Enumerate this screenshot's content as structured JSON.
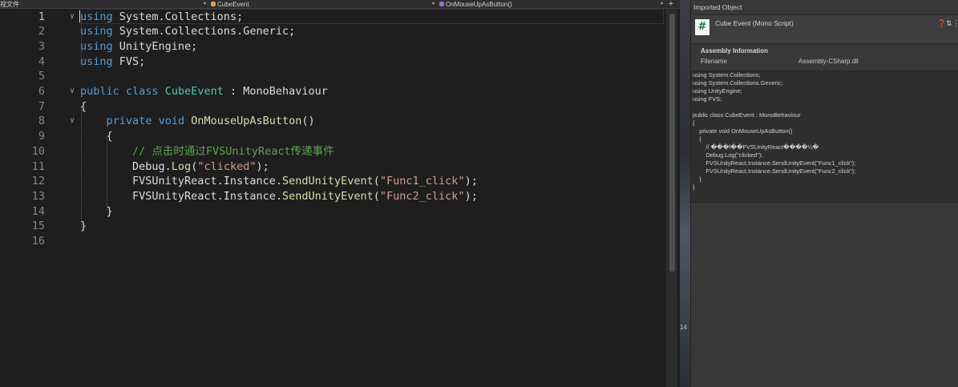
{
  "editor": {
    "nav": {
      "file_label": "视文件",
      "class_label": "CubeEvent",
      "method_label": "OnMouseUpAsButton()",
      "plus": "+"
    },
    "lines": [
      {
        "n": "1",
        "tokens": [
          [
            "kw",
            "using"
          ],
          [
            "t",
            " System.Collections;"
          ]
        ]
      },
      {
        "n": "2",
        "tokens": [
          [
            "kw",
            "using"
          ],
          [
            "t",
            " System.Collections.Generic;"
          ]
        ]
      },
      {
        "n": "3",
        "tokens": [
          [
            "kw",
            "using"
          ],
          [
            "t",
            " UnityEngine;"
          ]
        ]
      },
      {
        "n": "4",
        "tokens": [
          [
            "kw",
            "using"
          ],
          [
            "t",
            " FVS;"
          ]
        ]
      },
      {
        "n": "5",
        "tokens": []
      },
      {
        "n": "6",
        "tokens": [
          [
            "kw",
            "public"
          ],
          [
            "t",
            " "
          ],
          [
            "kw",
            "class"
          ],
          [
            "t",
            " "
          ],
          [
            "type",
            "CubeEvent"
          ],
          [
            "t",
            " : MonoBehaviour"
          ]
        ]
      },
      {
        "n": "7",
        "tokens": [
          [
            "t",
            "{"
          ]
        ]
      },
      {
        "n": "8",
        "tokens": [
          [
            "t",
            "    "
          ],
          [
            "kw",
            "private"
          ],
          [
            "t",
            " "
          ],
          [
            "kw",
            "void"
          ],
          [
            "t",
            " "
          ],
          [
            "method",
            "OnMouseUpAsButton"
          ],
          [
            "t",
            "()"
          ]
        ]
      },
      {
        "n": "9",
        "tokens": [
          [
            "t",
            "    {"
          ]
        ]
      },
      {
        "n": "10",
        "tokens": [
          [
            "t",
            "        "
          ],
          [
            "cmt",
            "// 点击时通过FVSUnityReact传递事件"
          ]
        ]
      },
      {
        "n": "11",
        "tokens": [
          [
            "t",
            "        Debug."
          ],
          [
            "method",
            "Log"
          ],
          [
            "t",
            "("
          ],
          [
            "str",
            "\"clicked\""
          ],
          [
            "t",
            ");"
          ]
        ]
      },
      {
        "n": "12",
        "tokens": [
          [
            "t",
            "        FVSUnityReact.Instance."
          ],
          [
            "method",
            "SendUnityEvent"
          ],
          [
            "t",
            "("
          ],
          [
            "str",
            "\"Func1_click\""
          ],
          [
            "t",
            ");"
          ]
        ]
      },
      {
        "n": "13",
        "tokens": [
          [
            "t",
            "        FVSUnityReact.Instance."
          ],
          [
            "method",
            "SendUnityEvent"
          ],
          [
            "t",
            "("
          ],
          [
            "str",
            "\"Func2_click\""
          ],
          [
            "t",
            ");"
          ]
        ]
      },
      {
        "n": "14",
        "tokens": [
          [
            "t",
            "    }"
          ]
        ]
      },
      {
        "n": "15",
        "tokens": [
          [
            "t",
            "}"
          ]
        ]
      },
      {
        "n": "16",
        "tokens": []
      }
    ]
  },
  "strip_number": "14",
  "inspector": {
    "title": "Imported Object",
    "object_name": "Cube Event (Mono Script)",
    "icons": [
      "help-icon",
      "settings-icon",
      "more-icon"
    ],
    "assembly": {
      "title": "Assembly Information",
      "filename_label": "Filename",
      "filename_value": "Assembly-CSharp.dll"
    },
    "preview_lines": [
      "using System.Collections;",
      "using System.Collections.Generic;",
      "using UnityEngine;",
      "using FVS;",
      "",
      "public class CubeEvent : MonoBehaviour",
      "{",
      "    private void OnMouseUpAsButton()",
      "    {",
      "        // ���f��FVSUnityReact����¼�",
      "        Debug.Log(\"clicked\");",
      "        FVSUnityReact.Instance.SendUnityEvent(\"Func1_click\");",
      "        FVSUnityReact.Instance.SendUnityEvent(\"Func2_click\");",
      "    }",
      "}"
    ]
  }
}
